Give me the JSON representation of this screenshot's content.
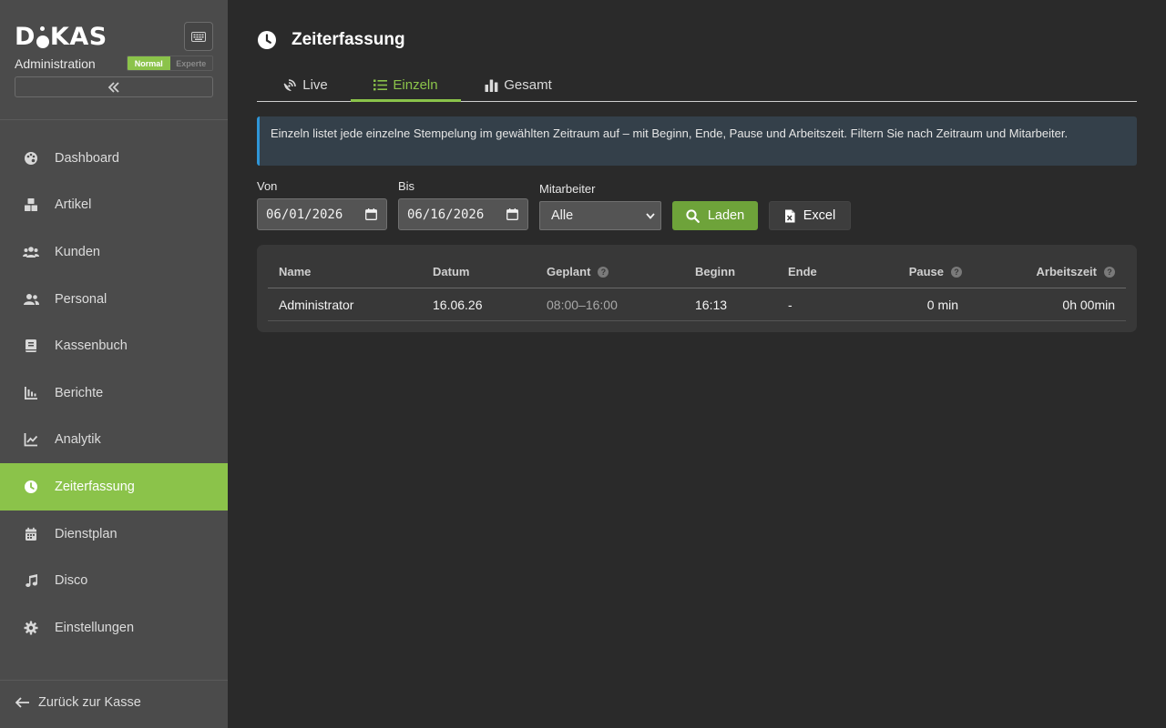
{
  "brand": {
    "logo_left": "D",
    "logo_right": "KAS",
    "subtitle": "Administration"
  },
  "mode": {
    "normal": "Normal",
    "expert": "Experte"
  },
  "sidebar": {
    "items": [
      {
        "label": "Dashboard",
        "icon": "palette-icon"
      },
      {
        "label": "Artikel",
        "icon": "boxes-icon"
      },
      {
        "label": "Kunden",
        "icon": "users-icon"
      },
      {
        "label": "Personal",
        "icon": "user-group-icon"
      },
      {
        "label": "Kassenbuch",
        "icon": "book-icon"
      },
      {
        "label": "Berichte",
        "icon": "bar-chart-icon"
      },
      {
        "label": "Analytik",
        "icon": "line-chart-icon"
      },
      {
        "label": "Zeiterfassung",
        "icon": "clock-icon",
        "active": true
      },
      {
        "label": "Dienstplan",
        "icon": "calendar-icon"
      },
      {
        "label": "Disco",
        "icon": "music-icon"
      },
      {
        "label": "Einstellungen",
        "icon": "gear-icon"
      }
    ],
    "back": "Zurück zur Kasse"
  },
  "page": {
    "title": "Zeiterfassung"
  },
  "tabs": [
    {
      "label": "Live",
      "icon": "satellite-dish-icon"
    },
    {
      "label": "Einzeln",
      "icon": "list-icon",
      "active": true
    },
    {
      "label": "Gesamt",
      "icon": "bar-chart-icon"
    }
  ],
  "info": "Einzeln listet jede einzelne Stempelung im gewählten Zeitraum auf – mit Beginn, Ende, Pause und Arbeitszeit. Filtern Sie nach Zeitraum und Mitarbeiter.",
  "filters": {
    "from_label": "Von",
    "from_value": "06/01/2026",
    "to_label": "Bis",
    "to_value": "06/16/2026",
    "employee_label": "Mitarbeiter",
    "employee_value": "Alle",
    "load_label": "Laden",
    "excel_label": "Excel"
  },
  "table": {
    "headers": [
      "Name",
      "Datum",
      "Geplant",
      "Beginn",
      "Ende",
      "Pause",
      "Arbeitszeit"
    ],
    "rows": [
      [
        "Administrator",
        "16.06.26",
        "08:00–16:00",
        "16:13",
        "-",
        "0 min",
        "0h 00min"
      ]
    ]
  },
  "colors": {
    "accent": "#8bc34a",
    "info_border": "#2f96d8",
    "sidebar_bg": "#4b4b4b",
    "main_bg": "#2a2a2a"
  }
}
